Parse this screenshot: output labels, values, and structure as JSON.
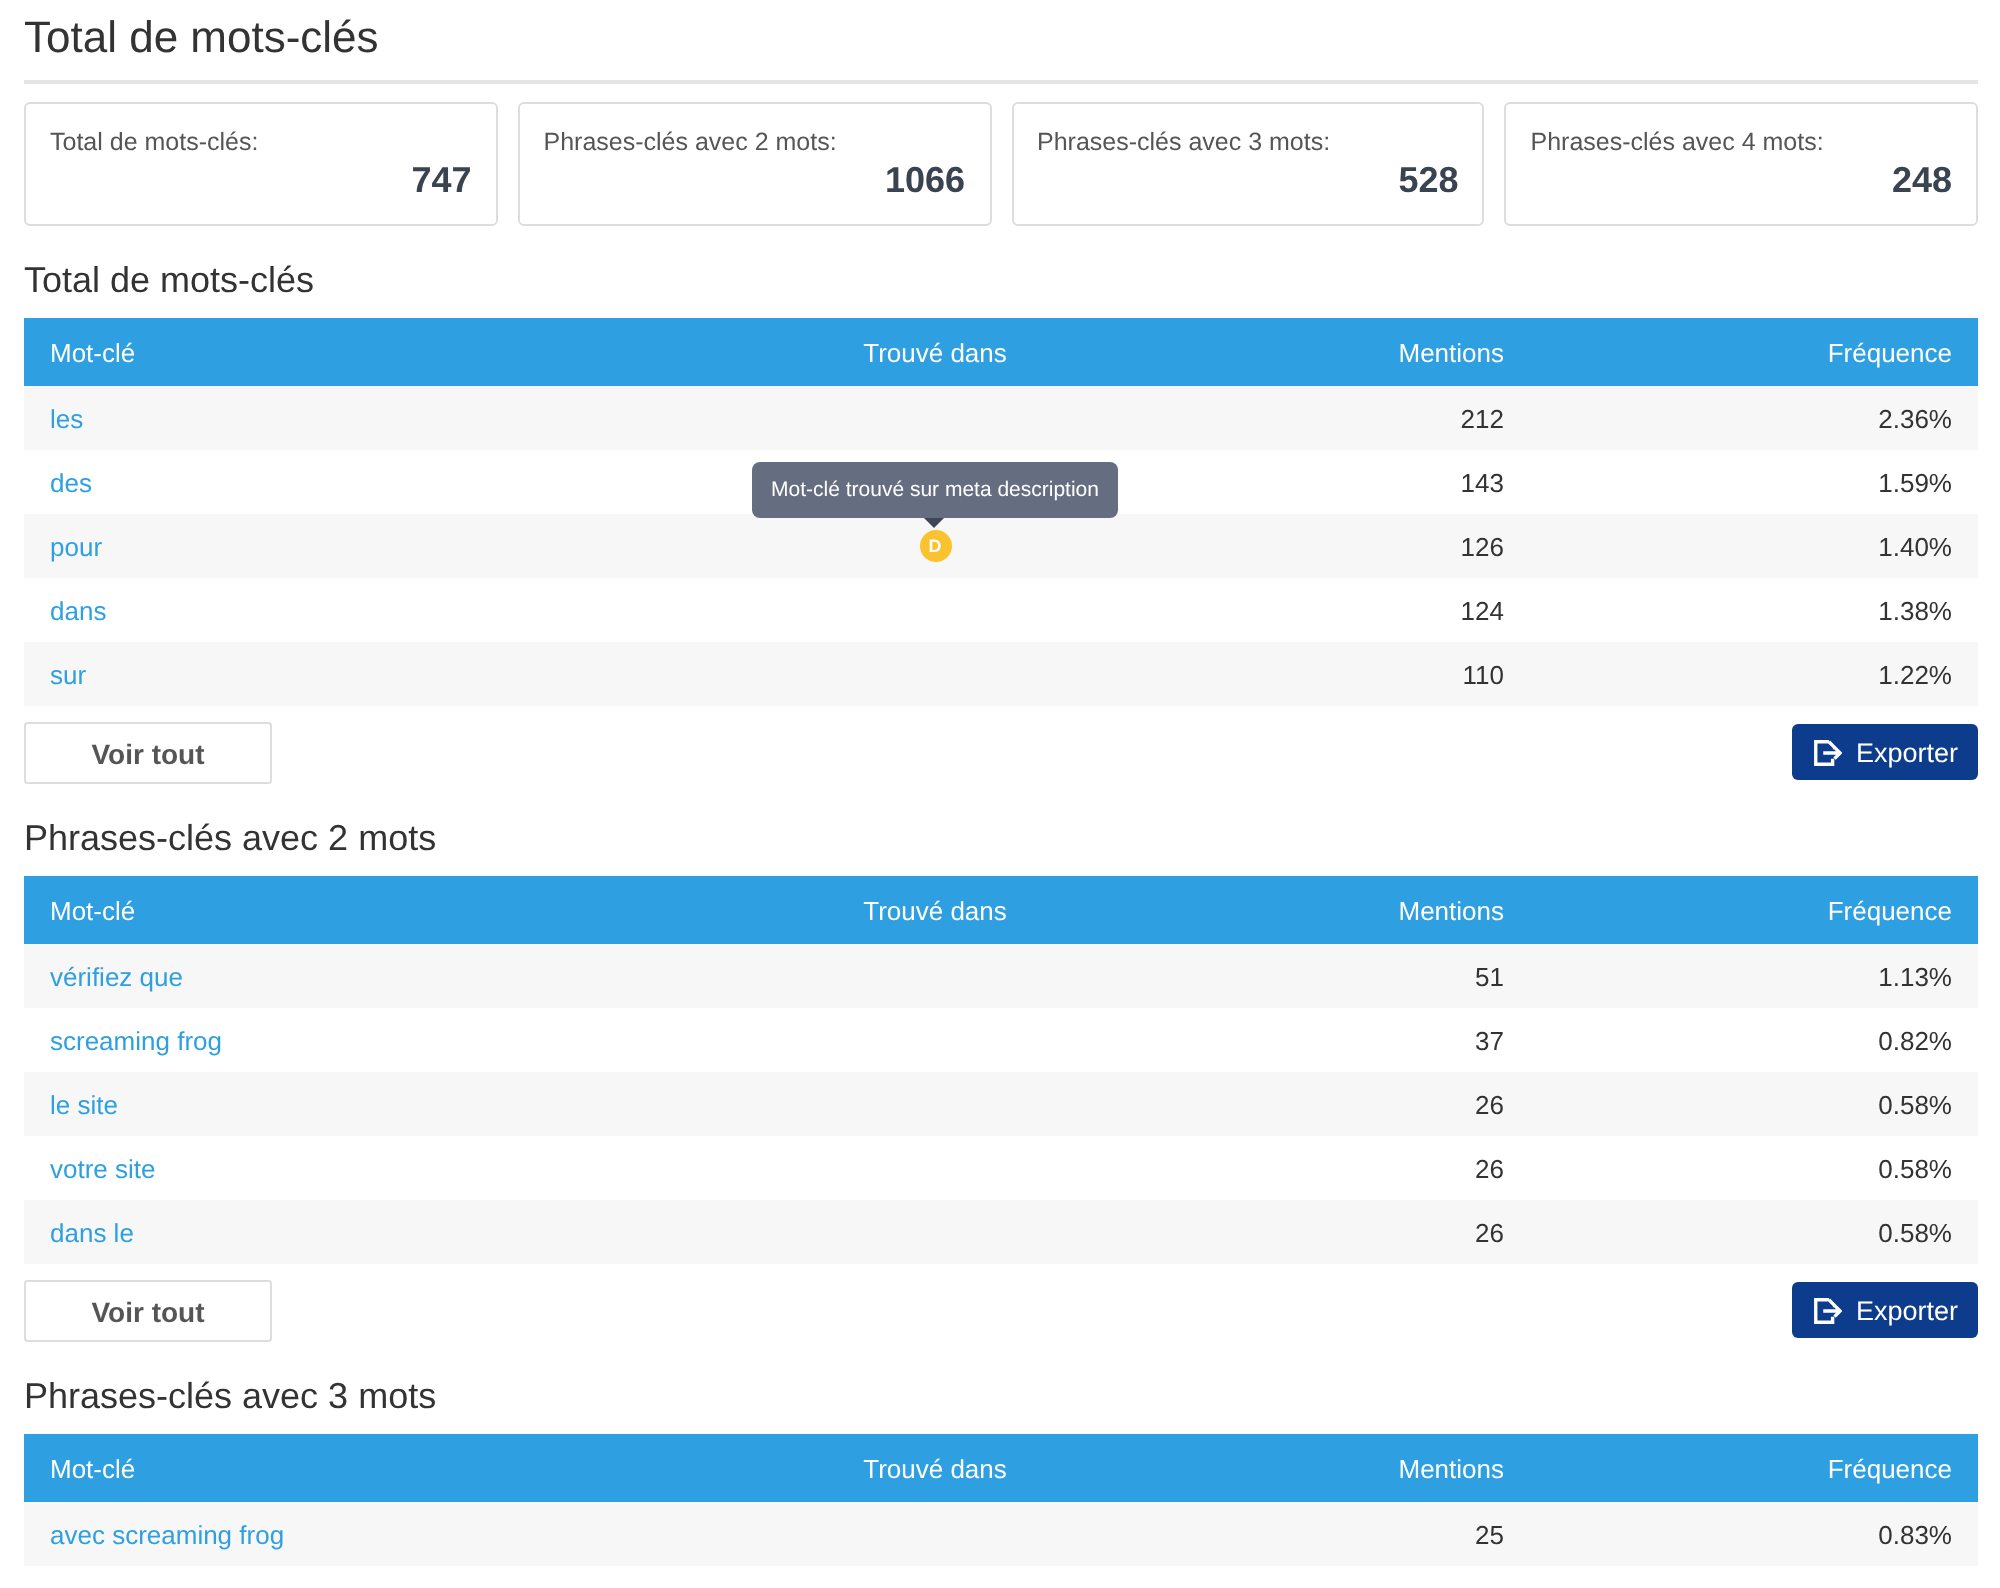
{
  "page_title": "Total de mots-clés",
  "summary_cards": [
    {
      "label": "Total de mots-clés:",
      "value": "747"
    },
    {
      "label": "Phrases-clés avec 2 mots:",
      "value": "1066"
    },
    {
      "label": "Phrases-clés avec 3 mots:",
      "value": "528"
    },
    {
      "label": "Phrases-clés avec 4 mots:",
      "value": "248"
    }
  ],
  "sections": [
    {
      "title": "Total de mots-clés",
      "columns": [
        "Mot-clé",
        "Trouvé dans",
        "Mentions",
        "Fréquence"
      ],
      "rows": [
        {
          "keyword": "les",
          "mentions": "212",
          "frequency": "2.36%"
        },
        {
          "keyword": "des",
          "mentions": "143",
          "frequency": "1.59%"
        },
        {
          "keyword": "pour",
          "mentions": "126",
          "frequency": "1.40%",
          "found_in": [
            {
              "letter": "D",
              "tooltip": "Mot-clé trouvé sur meta description"
            }
          ]
        },
        {
          "keyword": "dans",
          "mentions": "124",
          "frequency": "1.38%"
        },
        {
          "keyword": "sur",
          "mentions": "110",
          "frequency": "1.22%"
        }
      ],
      "view_all": "Voir tout",
      "export": "Exporter"
    },
    {
      "title": "Phrases-clés avec 2 mots",
      "columns": [
        "Mot-clé",
        "Trouvé dans",
        "Mentions",
        "Fréquence"
      ],
      "rows": [
        {
          "keyword": "vérifiez que",
          "mentions": "51",
          "frequency": "1.13%"
        },
        {
          "keyword": "screaming frog",
          "mentions": "37",
          "frequency": "0.82%"
        },
        {
          "keyword": "le site",
          "mentions": "26",
          "frequency": "0.58%"
        },
        {
          "keyword": "votre site",
          "mentions": "26",
          "frequency": "0.58%"
        },
        {
          "keyword": "dans le",
          "mentions": "26",
          "frequency": "0.58%"
        }
      ],
      "view_all": "Voir tout",
      "export": "Exporter"
    },
    {
      "title": "Phrases-clés avec 3 mots",
      "columns": [
        "Mot-clé",
        "Trouvé dans",
        "Mentions",
        "Fréquence"
      ],
      "rows": [
        {
          "keyword": "avec screaming frog",
          "mentions": "25",
          "frequency": "0.83%"
        }
      ]
    }
  ]
}
